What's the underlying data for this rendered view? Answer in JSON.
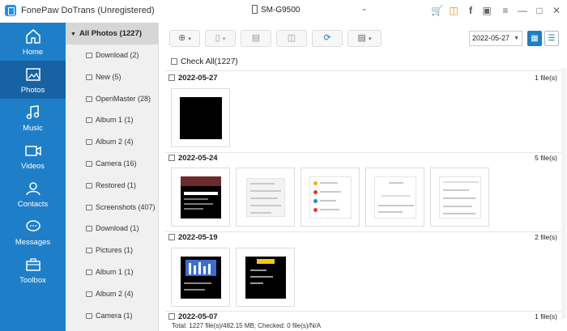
{
  "window": {
    "app_title": "FonePaw DoTrans (Unregistered)",
    "device_name": "SM-G9500"
  },
  "colors": {
    "accent": "#1e7fc8",
    "nav_active": "#1662a3",
    "orange": "#f28c00"
  },
  "nav": {
    "items": [
      {
        "label": "Home",
        "icon": "home-icon"
      },
      {
        "label": "Photos",
        "icon": "photo-icon",
        "active": true
      },
      {
        "label": "Music",
        "icon": "music-icon"
      },
      {
        "label": "Videos",
        "icon": "video-icon"
      },
      {
        "label": "Contacts",
        "icon": "contacts-icon"
      },
      {
        "label": "Messages",
        "icon": "messages-icon"
      },
      {
        "label": "Toolbox",
        "icon": "toolbox-icon"
      }
    ]
  },
  "albums": {
    "header": "All Photos (1227)",
    "items": [
      "Download (2)",
      "New (5)",
      "OpenMaster (28)",
      "Album 1 (1)",
      "Album 2 (4)",
      "Camera (16)",
      "Restored (1)",
      "Screenshots (407)",
      "Download (1)",
      "Pictures (1)",
      "Album 1 (1)",
      "Album 2 (4)",
      "Camera (1)"
    ]
  },
  "toolbar": {
    "date_value": "2022-05-27"
  },
  "content": {
    "check_all": "Check All(1227)",
    "groups": [
      {
        "date": "2022-05-27",
        "count": "1 file(s)"
      },
      {
        "date": "2022-05-24",
        "count": "5 file(s)"
      },
      {
        "date": "2022-05-19",
        "count": "2 file(s)"
      },
      {
        "date": "2022-05-07",
        "count": "1 file(s)"
      }
    ]
  },
  "status": {
    "text": "Total: 1227 file(s)/482.15 MB; Checked: 0 file(s)/N/A"
  }
}
